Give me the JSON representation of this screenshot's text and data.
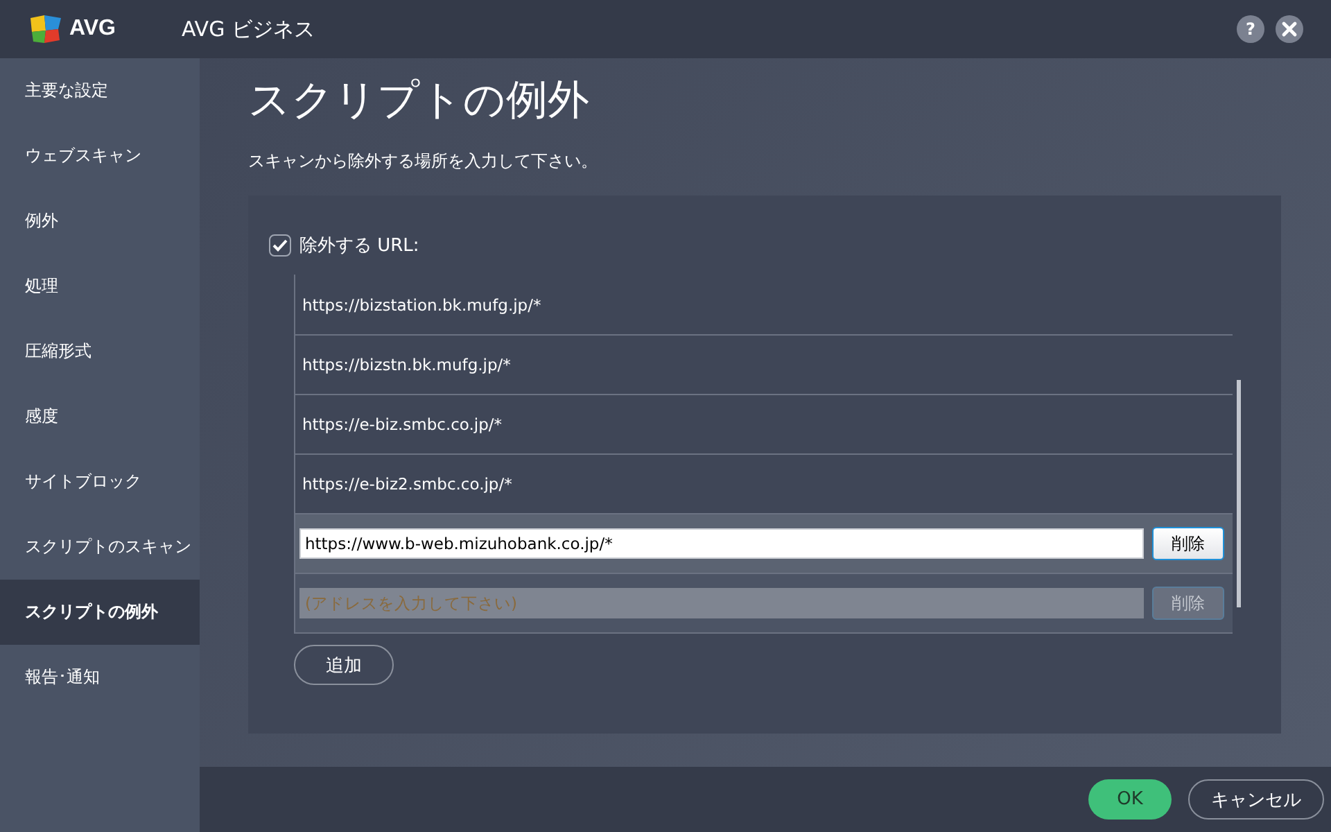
{
  "window": {
    "brand": "AVG",
    "title": "AVG ビジネス",
    "help": "?"
  },
  "sidebar": {
    "items": [
      {
        "label": "主要な設定",
        "selected": false
      },
      {
        "label": "ウェブスキャン",
        "selected": false
      },
      {
        "label": "例外",
        "selected": false
      },
      {
        "label": "処理",
        "selected": false
      },
      {
        "label": "圧縮形式",
        "selected": false
      },
      {
        "label": "感度",
        "selected": false
      },
      {
        "label": "サイトブロック",
        "selected": false
      },
      {
        "label": "スクリプトのスキャン",
        "selected": false
      },
      {
        "label": "スクリプトの例外",
        "selected": true
      },
      {
        "label": "報告･通知",
        "selected": false
      }
    ]
  },
  "heading": "スクリプトの例外",
  "description": "スキャンから除外する場所を入力して下さい。",
  "exclusions": {
    "label": "除外する URL:",
    "checked": true,
    "rows": [
      {
        "kind": "text",
        "url": "https://bizstation.bk.mufg.jp/*"
      },
      {
        "kind": "text",
        "url": "https://bizstn.bk.mufg.jp/*"
      },
      {
        "kind": "text",
        "url": "https://e-biz.smbc.co.jp/*"
      },
      {
        "kind": "text",
        "url": "https://e-biz2.smbc.co.jp/*"
      },
      {
        "kind": "edit",
        "value": "https://www.b-web.mizuhobank.co.jp/*",
        "button": "削除",
        "disabled": false
      },
      {
        "kind": "edit",
        "placeholder": "(アドレスを入力して下さい)",
        "button": "削除",
        "disabled": true
      }
    ],
    "add_button": "追加"
  },
  "footer": {
    "ok": "OK",
    "cancel": "キャンセル"
  }
}
